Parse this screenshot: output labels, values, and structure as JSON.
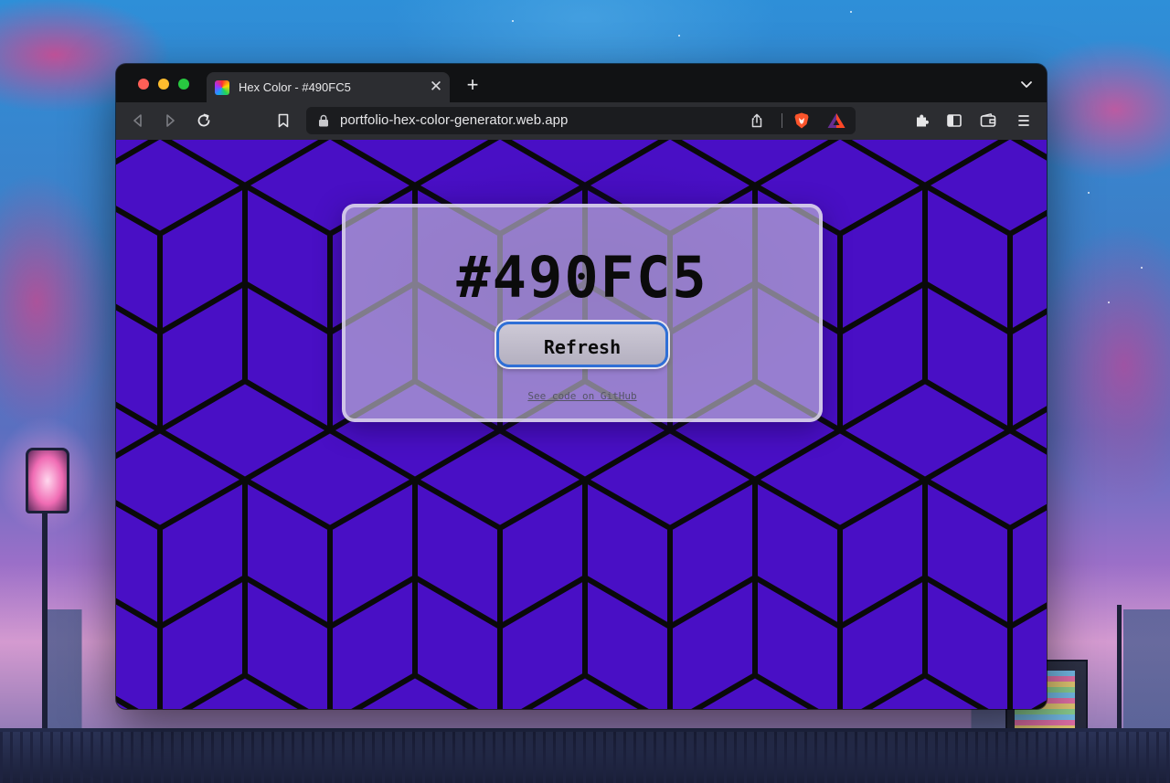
{
  "browser": {
    "tab": {
      "title": "Hex Color - #490FC5",
      "close_glyph": "✕",
      "favicon": "rainbow-color-wheel-icon"
    },
    "new_tab_glyph": "+",
    "address": {
      "url": "portfolio-hex-color-generator.web.app",
      "secure": true
    },
    "toolbar_icons": [
      "back-icon",
      "forward-icon",
      "reload-icon",
      "bookmark-icon",
      "share-icon",
      "brave-shields-icon",
      "brave-rewards-icon",
      "extensions-icon",
      "sidebar-icon",
      "wallet-icon",
      "menu-icon"
    ]
  },
  "page": {
    "hex_code": "#490FC5",
    "refresh_label": "Refresh",
    "github_link_label": "See code on GitHub"
  },
  "colors": {
    "background": "#490FC5",
    "pattern_lines": "#0a0a0a",
    "button_border": "#2f6fd6",
    "traffic_red": "#fe5f57",
    "traffic_yellow": "#febc2e",
    "traffic_green": "#28c840"
  }
}
